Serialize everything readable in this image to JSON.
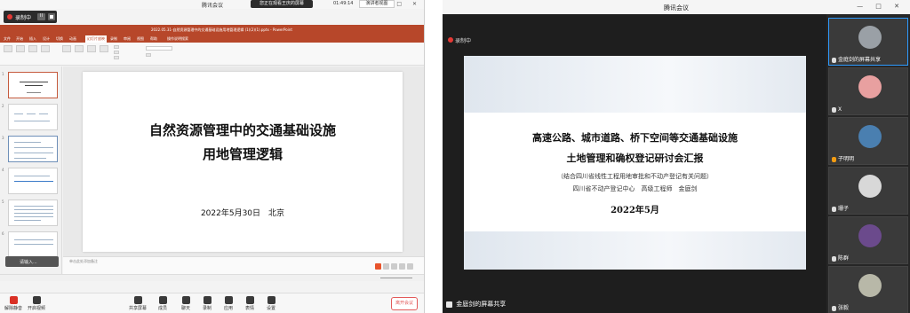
{
  "left_window": {
    "title": "腾讯会议",
    "window_controls": "— □ ✕",
    "recording": {
      "label": "录制中",
      "pause_icon": "II"
    },
    "viewing_badge": "您正在观看王庆的屏幕",
    "timer": "01:49:14",
    "view_mode": "演讲者视图",
    "ppt": {
      "window_title": "2022.05.31-自然资源管理中的交通基础设施用地管理逻辑 (1)(2)(1).pptx - PowerPoint",
      "tabs": [
        "文件",
        "开始",
        "插入",
        "设计",
        "切换",
        "动画",
        "幻灯片放映",
        "录制",
        "审阅",
        "视图",
        "帮助",
        "操作说明搜索"
      ],
      "active_tab": "幻灯片放映",
      "slide_title_line1": "自然资源管理中的交通基础设施",
      "slide_title_line2": "用地管理逻辑",
      "slide_date": "2022年5月30日　北京",
      "notes_placeholder": "单击此处添加备注"
    },
    "toolbar": {
      "mute": "解除静音",
      "video": "开启视频",
      "share": "共享屏幕",
      "members": "成员",
      "chat": "聊天",
      "record": "录制",
      "apps": "应用",
      "reactions": "表情",
      "settings": "设置",
      "leave": "离开会议"
    },
    "chat_bubble": "请输入..."
  },
  "right_window": {
    "title": "腾讯会议",
    "window_controls": "— □ ✕",
    "recording_label": "录制中",
    "slide": {
      "line1": "高速公路、城市道路、桥下空间等交通基础设施",
      "line2": "土地管理和确权登记研讨会汇报",
      "subtitle": "（结合四川省线性工程用地审批和不动产登记有关问题）",
      "author": "四川省不动产登记中心　高级工程师　金庭剑",
      "date": "2022年5月"
    },
    "presenter_label": "金庭剑的屏幕共享",
    "participants": [
      {
        "name": "金庭剑的屏幕共享",
        "color": "#9aa0a6"
      },
      {
        "name": "X",
        "color": "#e8a0a0"
      },
      {
        "name": "子明明",
        "color": "#4a7fb0"
      },
      {
        "name": "珊子",
        "color": "#d8d8d8"
      },
      {
        "name": "陈群",
        "color": "#6b4a8c"
      },
      {
        "name": "张毅",
        "color": "#b8b8a8"
      }
    ]
  }
}
